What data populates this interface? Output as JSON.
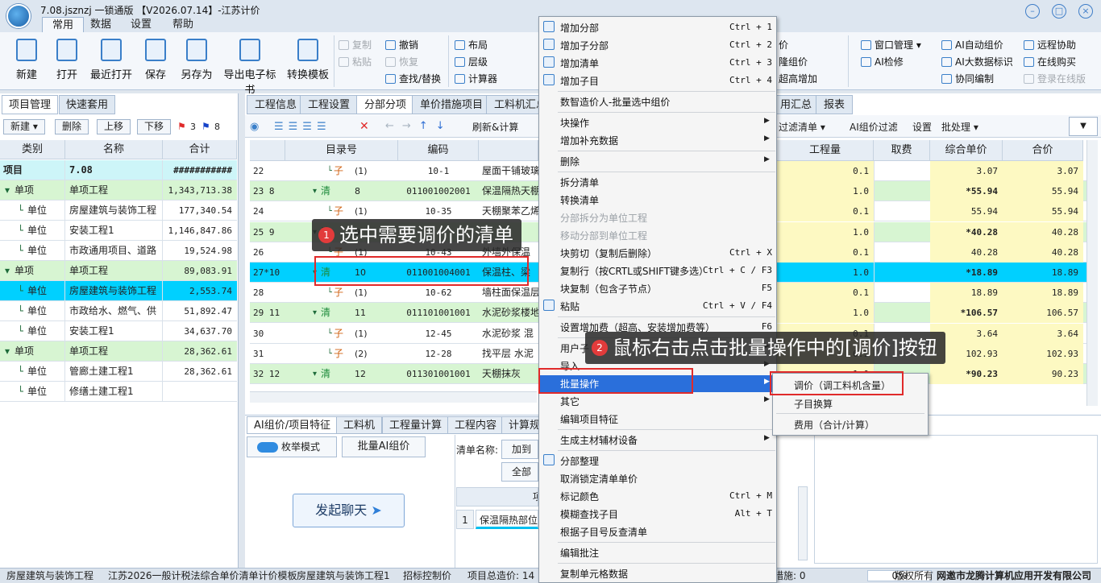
{
  "title": "7.08.jsznzj 一锁通版 【V2026.07.14】-江苏计价",
  "menu_tabs": [
    "常用",
    "数据",
    "设置",
    "帮助"
  ],
  "ribbon": {
    "big_buttons": [
      "新建",
      "打开",
      "最近打开",
      "保存",
      "另存为",
      "导出电子标书",
      "转换模板"
    ],
    "edit_group": [
      "复制",
      "粘贴",
      "撤销",
      "恢复",
      "查找/替换"
    ],
    "layout_group": [
      "布局",
      "层级",
      "计算器"
    ],
    "right_col1": [
      "价",
      "隆组价",
      "超高增加"
    ],
    "right_col2": [
      "窗口管理",
      "AI检修"
    ],
    "right_col3": [
      "AI自动组价",
      "AI大数据标识",
      "协同编制"
    ],
    "right_col4": [
      "远程协助",
      "在线购买",
      "登录在线版"
    ]
  },
  "left": {
    "tabs": [
      "项目管理",
      "快速套用"
    ],
    "buttons": [
      "新建",
      "删除",
      "上移",
      "下移"
    ],
    "flag_counts": [
      "3",
      "8"
    ],
    "headers": [
      "类别",
      "名称",
      "合计"
    ],
    "rows": [
      {
        "type": "项目",
        "name": "7.08",
        "total": "###########"
      },
      {
        "type": "单项",
        "name": "单项工程",
        "total": "1,343,713.38"
      },
      {
        "type": "单位",
        "name": "房屋建筑与装饰工程",
        "total": "177,340.54"
      },
      {
        "type": "单位",
        "name": "安装工程1",
        "total": "1,146,847.86"
      },
      {
        "type": "单位",
        "name": "市政通用项目、道路",
        "total": "19,524.98"
      },
      {
        "type": "单项",
        "name": "单项工程",
        "total": "89,083.91"
      },
      {
        "type": "单位",
        "name": "房屋建筑与装饰工程",
        "total": "2,553.74"
      },
      {
        "type": "单位",
        "name": "市政给水、燃气、供",
        "total": "51,892.47"
      },
      {
        "type": "单位",
        "name": "安装工程1",
        "total": "34,637.70"
      },
      {
        "type": "单项",
        "name": "单项工程",
        "total": "28,362.61"
      },
      {
        "type": "单位",
        "name": "管廊土建工程1",
        "total": "28,362.61"
      },
      {
        "type": "单位",
        "name": "修缮土建工程1",
        "total": ""
      }
    ]
  },
  "right": {
    "tabs": [
      "工程信息",
      "工程设置",
      "分部分项",
      "单价措施项目",
      "工料机汇总",
      "用汇总",
      "报表"
    ],
    "toolbar": [
      "刷新&计算",
      "过滤清单",
      "AI组价过滤",
      "设置",
      "批处理"
    ],
    "headers": [
      "目录号",
      "编码",
      "工程量",
      "取费",
      "综合单价",
      "合价"
    ],
    "rows": [
      {
        "no": "22",
        "kind": "子",
        "dir": "(1)",
        "code": "10-1",
        "name": "屋面干铺玻璃",
        "qty": "0.1",
        "unit": "3.07",
        "total": "3.07"
      },
      {
        "no": "23 8",
        "kind": "清",
        "dir": "8",
        "code": "011001002001",
        "name": "保温隔热天棚",
        "qty": "1.0",
        "unit": "*55.94",
        "total": "55.94"
      },
      {
        "no": "24",
        "kind": "子",
        "dir": "(1)",
        "code": "10-35",
        "name": "天棚聚苯乙烯",
        "qty": "0.1",
        "unit": "55.94",
        "total": "55.94"
      },
      {
        "no": "25 9",
        "kind": "清",
        "dir": "9",
        "code": "",
        "name": "",
        "qty": "1.0",
        "unit": "*40.28",
        "total": "40.28"
      },
      {
        "no": "26",
        "kind": "子",
        "dir": "(1)",
        "code": "10-43",
        "name": "外墙外保温",
        "qty": "0.1",
        "unit": "40.28",
        "total": "40.28"
      },
      {
        "no": "27*10",
        "kind": "清",
        "dir": "10",
        "code": "011001004001",
        "name": "保温柱、梁",
        "qty": "1.0",
        "unit": "*18.89",
        "total": "18.89"
      },
      {
        "no": "28",
        "kind": "子",
        "dir": "(1)",
        "code": "10-62",
        "name": "墙柱面保温层",
        "qty": "0.1",
        "unit": "18.89",
        "total": "18.89"
      },
      {
        "no": "29 11",
        "kind": "清",
        "dir": "11",
        "code": "011101001001",
        "name": "水泥砂浆楼地面",
        "qty": "1.0",
        "unit": "*106.57",
        "total": "106.57"
      },
      {
        "no": "30",
        "kind": "子",
        "dir": "(1)",
        "code": "12-45",
        "name": "水泥砂浆 混",
        "qty": "0.1",
        "unit": "3.64",
        "total": "3.64"
      },
      {
        "no": "31",
        "kind": "子",
        "dir": "(2)",
        "code": "12-28",
        "name": "找平层 水泥",
        "qty": "0.1",
        "unit": "102.93",
        "total": "102.93"
      },
      {
        "no": "32 12",
        "kind": "清",
        "dir": "12",
        "code": "011301001001",
        "name": "天棚抹灰",
        "qty": "1.0",
        "unit": "*90.23",
        "total": "90.23"
      }
    ]
  },
  "bottom": {
    "tabs": [
      "AI组价/项目特征",
      "工料机",
      "工程量计算",
      "工程内容",
      "计算规"
    ],
    "enum_mode": "枚举模式",
    "batch_ai": "批量AI组价",
    "chat_button": "发起聊天",
    "list_name_label": "清单名称:",
    "add_button": "加到名",
    "delete_all": "全部删",
    "list_row_no": "1",
    "list_row_text": "保温隔热部位",
    "list_header": "项"
  },
  "status": [
    "房屋建筑与装饰工程",
    "江苏2026一般计税法综合单价清单计价模板",
    "房屋建筑与装饰工程1",
    "招标控制价",
    "项目总造价: 14",
    "措施: 0",
    "0%",
    "版权所有",
    "网邀市龙腾计算机应用开发有限公司"
  ],
  "context_menu": {
    "items": [
      {
        "label": "增加分部",
        "shortcut": "Ctrl + 1"
      },
      {
        "label": "增加子分部",
        "shortcut": "Ctrl + 2"
      },
      {
        "label": "增加清单",
        "shortcut": "Ctrl + 3"
      },
      {
        "label": "增加子目",
        "shortcut": "Ctrl + 4"
      },
      {
        "label": "数智造价人-批量选中组价",
        "shortcut": ""
      },
      {
        "label": "块操作",
        "shortcut": ""
      },
      {
        "label": "增加补充数据",
        "shortcut": ""
      },
      {
        "label": "删除",
        "shortcut": ""
      },
      {
        "label": "拆分清单",
        "shortcut": ""
      },
      {
        "label": "转换清单",
        "shortcut": ""
      },
      {
        "label": "分部拆分为单位工程",
        "shortcut": ""
      },
      {
        "label": "移动分部到单位工程",
        "shortcut": ""
      },
      {
        "label": "块剪切（复制后删除）",
        "shortcut": "Ctrl + X"
      },
      {
        "label": "复制行（按CRTL或SHIFT键多选）",
        "shortcut": "Ctrl + C / F3"
      },
      {
        "label": "块复制（包含子节点）",
        "shortcut": "F5"
      },
      {
        "label": "粘贴",
        "shortcut": "Ctrl + V / F4"
      },
      {
        "label": "设置增加费（超高、安装增加费等）",
        "shortcut": "F6"
      },
      {
        "label": "用户子",
        "shortcut": ""
      },
      {
        "label": "导入",
        "shortcut": ""
      },
      {
        "label": "批量操作",
        "shortcut": ""
      },
      {
        "label": "其它",
        "shortcut": ""
      },
      {
        "label": "编辑项目特征",
        "shortcut": ""
      },
      {
        "label": "生成主材辅材设备",
        "shortcut": ""
      },
      {
        "label": "分部整理",
        "shortcut": ""
      },
      {
        "label": "取消锁定清单单价",
        "shortcut": ""
      },
      {
        "label": "标记颜色",
        "shortcut": "Ctrl + M"
      },
      {
        "label": "模糊查找子目",
        "shortcut": "Alt + T"
      },
      {
        "label": "根据子目号反查清单",
        "shortcut": ""
      },
      {
        "label": "编辑批注",
        "shortcut": ""
      },
      {
        "label": "复制单元格数据",
        "shortcut": ""
      }
    ],
    "submenu": [
      "调价（调工料机含量）",
      "子目换算",
      "费用（合计/计算）"
    ]
  },
  "callouts": [
    {
      "num": "1",
      "text": "选中需要调价的清单"
    },
    {
      "num": "2",
      "text": "鼠标右击点击批量操作中的[调价]按钮"
    }
  ]
}
